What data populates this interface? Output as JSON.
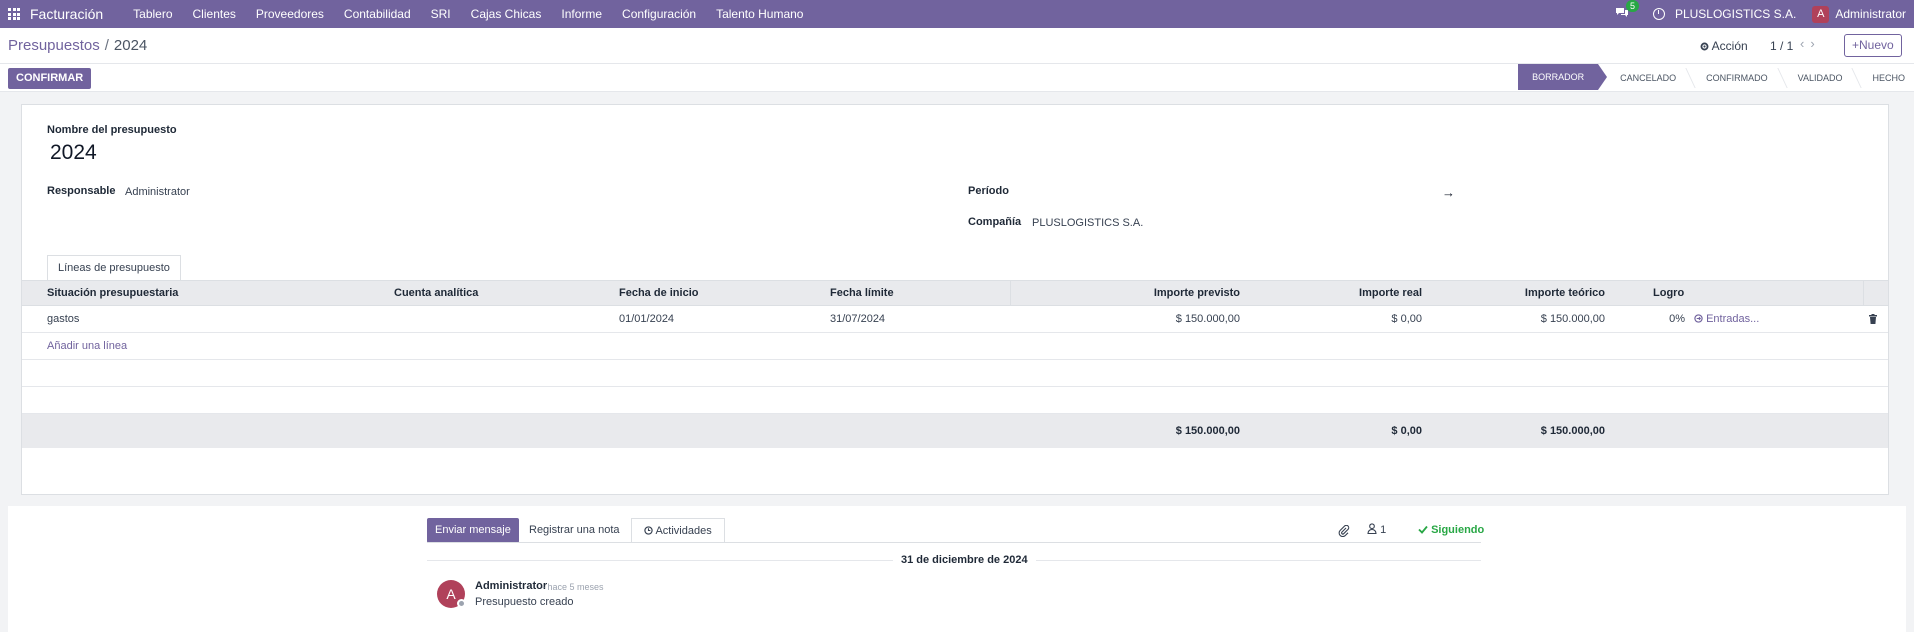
{
  "navbar": {
    "brand": "Facturación",
    "menu": [
      "Tablero",
      "Clientes",
      "Proveedores",
      "Contabilidad",
      "SRI",
      "Cajas Chicas",
      "Informe",
      "Configuración",
      "Talento Humano"
    ],
    "chat_count": "5",
    "company": "PLUSLOGISTICS S.A.",
    "user_initial": "A",
    "user": "Administrator",
    "accent": "#71639e"
  },
  "control": {
    "breadcrumb_parent": "Presupuestos",
    "breadcrumb_sep": "/",
    "breadcrumb_current": "2024",
    "action": "Acción",
    "pager": "1 / 1",
    "new": "Nuevo"
  },
  "statusbar": {
    "confirm": "CONFIRMAR",
    "stages": [
      "BORRADOR",
      "CANCELADO",
      "CONFIRMADO",
      "VALIDADO",
      "HECHO"
    ],
    "active_stage": "BORRADOR"
  },
  "form": {
    "name_label": "Nombre del presupuesto",
    "name": "2024",
    "responsible_label": "Responsable",
    "responsible": "Administrator",
    "period_label": "Período",
    "period_arrow": "→",
    "company_label": "Compañía",
    "company": "PLUSLOGISTICS S.A."
  },
  "lines": {
    "tab": "Líneas de presupuesto",
    "headers": {
      "position": "Situación presupuestaria",
      "analytic": "Cuenta analítica",
      "start": "Fecha de inicio",
      "end": "Fecha límite",
      "planned": "Importe previsto",
      "real": "Importe real",
      "theoretical": "Importe teórico",
      "achievement": "Logro"
    },
    "rows": [
      {
        "position": "gastos",
        "analytic": "",
        "start": "01/01/2024",
        "end": "31/07/2024",
        "planned": "$ 150.000,00",
        "real": "$ 0,00",
        "theoretical": "$ 150.000,00",
        "achievement": "0%",
        "entries": "Entradas..."
      }
    ],
    "add_line": "Añadir una línea",
    "totals": {
      "planned": "$ 150.000,00",
      "real": "$ 0,00",
      "theoretical": "$ 150.000,00"
    }
  },
  "chatter": {
    "send": "Enviar mensaje",
    "note": "Registrar una nota",
    "activities": "Actividades",
    "followers": "1",
    "following": "Siguiendo",
    "date": "31 de diciembre de 2024",
    "message": {
      "initial": "A",
      "author": "Administrator",
      "time": "- hace 5 meses",
      "body": "Presupuesto creado"
    }
  }
}
